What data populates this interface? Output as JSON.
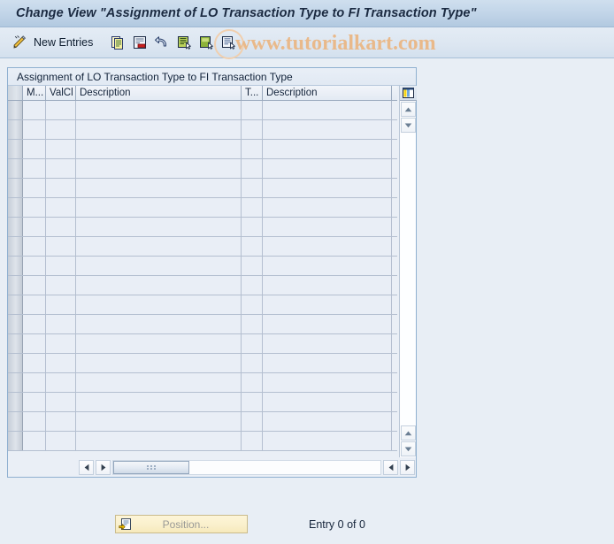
{
  "window": {
    "title": "Change View \"Assignment of LO Transaction Type to FI Transaction Type\""
  },
  "toolbar": {
    "pencil_icon": "pencil-edit-icon",
    "new_entries_label": "New Entries",
    "icons": [
      {
        "name": "copy-icon",
        "title": "Copy As..."
      },
      {
        "name": "delete-row-icon",
        "title": "Delete"
      },
      {
        "name": "undo-icon",
        "title": "Undo Change"
      },
      {
        "name": "select-all-icon",
        "title": "Select All"
      },
      {
        "name": "deselect-all-icon",
        "title": "Deselect All"
      },
      {
        "name": "details-icon",
        "title": "Details"
      }
    ]
  },
  "watermark": {
    "text": "www.tutorialkart.com"
  },
  "table": {
    "caption": "Assignment of LO Transaction Type to FI Transaction Type",
    "columns": [
      {
        "key": "select",
        "label": "",
        "name": "row-selector-column"
      },
      {
        "key": "movement",
        "label": "M...",
        "name": "column-movement-type"
      },
      {
        "key": "valcl",
        "label": "ValCl",
        "name": "column-valuation-class"
      },
      {
        "key": "description1",
        "label": "Description",
        "name": "column-description-1"
      },
      {
        "key": "ttype",
        "label": "T...",
        "name": "column-transaction-type"
      },
      {
        "key": "description2",
        "label": "Description",
        "name": "column-description-2"
      }
    ],
    "rows": [],
    "empty_row_count": 18,
    "column_config_icon": "column-settings-icon"
  },
  "scrollbars": {
    "vertical": {
      "up_icon": "scroll-up-icon",
      "down_icon": "scroll-down-icon",
      "page_up_icon": "page-up-icon",
      "page_down_icon": "page-down-icon"
    },
    "horizontal": {
      "left_icon": "scroll-left-icon",
      "right_icon": "scroll-right-icon",
      "thumb_grip_icon": "scroll-thumb-grip-icon"
    }
  },
  "footer": {
    "position_button": {
      "label": "Position...",
      "icon": "position-icon",
      "enabled": false
    },
    "entry_status": "Entry 0 of 0"
  },
  "colors": {
    "title_bar": "#c3d6e9",
    "toolbar": "#dce6f1",
    "page_background": "#e8eef5",
    "grid_cell": "#e9eef6",
    "grid_line": "#b4bfd0",
    "frame_border": "#8fb0d0",
    "watermark": "#e9b98a",
    "button_yellow": "#faf0cc"
  }
}
